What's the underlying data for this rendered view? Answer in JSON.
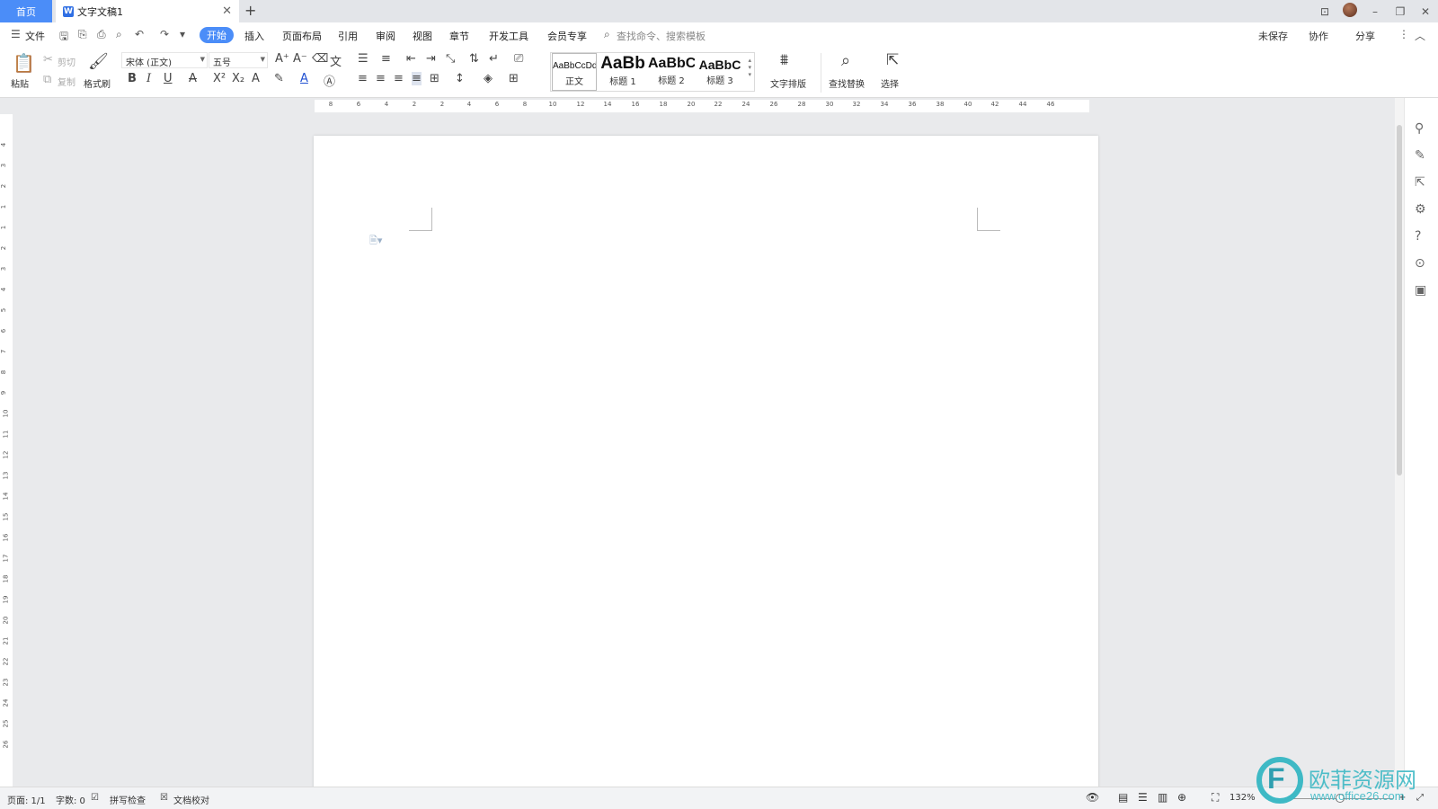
{
  "app": {
    "home_tab": "首页",
    "doc_tab": "文字文稿1",
    "doc_tab_logo": "W",
    "tab_close": "✕",
    "add_tab": "+"
  },
  "window": {
    "icons": [
      "layout-icon",
      "minimize-icon",
      "restore-icon",
      "close-icon"
    ],
    "minimize": "–",
    "restore": "❐",
    "close": "✕",
    "layout": "⊡"
  },
  "menubar": {
    "file": "文件",
    "tabs": [
      "开始",
      "插入",
      "页面布局",
      "引用",
      "审阅",
      "视图",
      "章节",
      "开发工具",
      "会员专享"
    ],
    "search_placeholder": "查找命令、搜索模板",
    "unsaved": "未保存",
    "collab": "协作",
    "share": "分享"
  },
  "ribbon": {
    "paste": "粘贴",
    "cut": "剪切",
    "copy": "复制",
    "format_painter": "格式刷",
    "font_name": "宋体 (正文)",
    "font_size": "五号",
    "styles": [
      {
        "preview": "AaBbCcDd",
        "name": "正文"
      },
      {
        "preview": "AaBb",
        "name": "标题 1"
      },
      {
        "preview": "AaBbC",
        "name": "标题 2"
      },
      {
        "preview": "AaBbC",
        "name": "标题 3"
      }
    ],
    "text_layout": "文字排版",
    "find_replace": "查找替换",
    "select": "选择"
  },
  "ruler": {
    "h_numbers": [
      "8",
      "6",
      "4",
      "2",
      "2",
      "4",
      "6",
      "8",
      "10",
      "12",
      "14",
      "16",
      "18",
      "20",
      "22",
      "24",
      "26",
      "28",
      "30",
      "32",
      "34",
      "36",
      "38",
      "40",
      "42",
      "44",
      "46"
    ],
    "v_numbers": [
      "4",
      "3",
      "2",
      "1",
      "1",
      "2",
      "3",
      "4",
      "5",
      "6",
      "7",
      "8",
      "9",
      "10",
      "11",
      "12",
      "13",
      "14",
      "15",
      "16",
      "17",
      "18",
      "19",
      "20",
      "21",
      "22",
      "23",
      "24",
      "25",
      "26"
    ]
  },
  "statusbar": {
    "page": "页面: 1/1",
    "words": "字数: 0",
    "spellcheck": "拼写检查",
    "doc_proof": "文档校对",
    "zoom": "132%",
    "zoom_minus": "–",
    "zoom_plus": "+"
  },
  "watermark": {
    "text_cn": "欧菲资源网",
    "text_url": "www.office26.com"
  },
  "colors": {
    "accent": "#4b8df8",
    "watermark": "#3eb9c5"
  }
}
